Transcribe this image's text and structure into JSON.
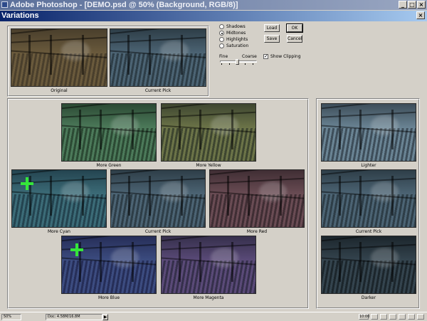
{
  "app": {
    "title": "Adobe Photoshop - [DEMO.psd @ 50% (Background, RGB/8)]"
  },
  "dialog": {
    "title": "Variations"
  },
  "preview": {
    "original_label": "Original",
    "current_pick_label": "Current Pick"
  },
  "tone_options": [
    {
      "label": "Shadows",
      "selected": false
    },
    {
      "label": "Midtones",
      "selected": true
    },
    {
      "label": "Highlights",
      "selected": false
    },
    {
      "label": "Saturation",
      "selected": false
    }
  ],
  "buttons": {
    "load": "Load",
    "save": "Save",
    "ok": "OK",
    "cancel": "Cancel"
  },
  "slider": {
    "fine_label": "Fine",
    "coarse_label": "Coarse",
    "level": 0.5
  },
  "show_clipping": {
    "label": "Show Clipping",
    "checked": true,
    "mark": "✓"
  },
  "color_grid": {
    "more_green": "More Green",
    "more_yellow": "More Yellow",
    "more_cyan": "More Cyan",
    "current_pick": "Current Pick",
    "more_red": "More Red",
    "more_blue": "More Blue",
    "more_magenta": "More Magenta"
  },
  "brightness": {
    "lighter": "Lighter",
    "current_pick": "Current Pick",
    "darker": "Darker"
  },
  "status_bar": {
    "zoom": "50%",
    "doc_size": "Doc: 4.58M/16.8M",
    "arrow": "▶",
    "clock": "10:00"
  },
  "tints": {
    "original": [
      "#6a5a3c",
      "#4a3f2c"
    ],
    "current": [
      "#4c6474",
      "#2e3e48"
    ],
    "green": [
      "#4c7a5a",
      "#2c4a34"
    ],
    "yellow": [
      "#6c7448",
      "#3e4630"
    ],
    "cyan": [
      "#3c6c78",
      "#244450"
    ],
    "red": [
      "#6a4c54",
      "#402e34"
    ],
    "blue": [
      "#3c4c80",
      "#262e58"
    ],
    "magenta": [
      "#5a4a78",
      "#36304c"
    ],
    "lighter": [
      "#6a8494",
      "#3e4e5a"
    ],
    "darker": [
      "#34444e",
      "#1c262c"
    ],
    "accent_cross": "#35e63a"
  }
}
